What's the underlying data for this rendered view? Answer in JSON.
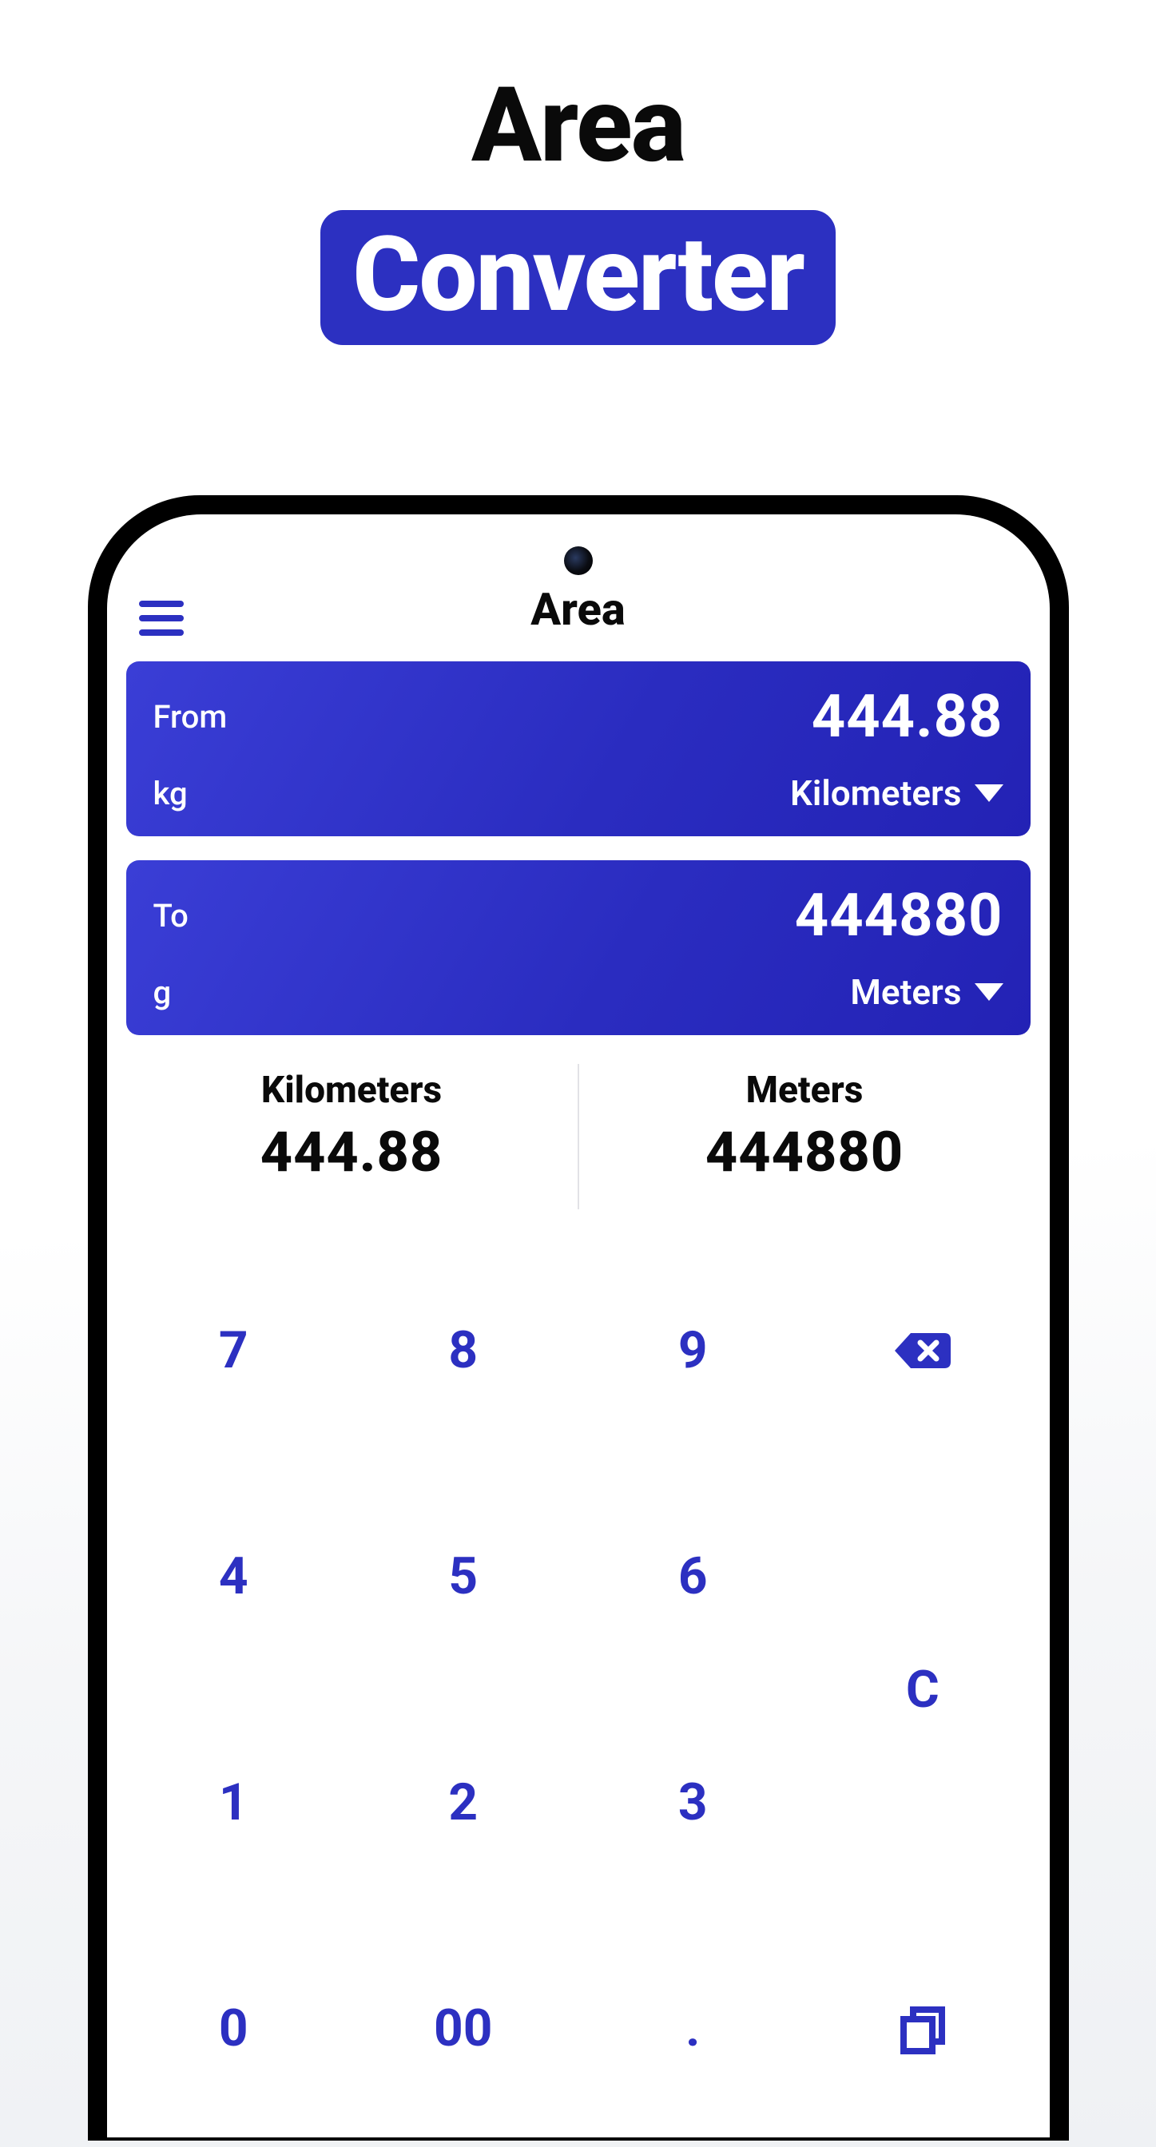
{
  "promo": {
    "line1": "Area",
    "line2": "Converter"
  },
  "appbar": {
    "title": "Area"
  },
  "from": {
    "label": "From",
    "abbr": "kg",
    "value": "444.88",
    "unit": "Kilometers"
  },
  "to": {
    "label": "To",
    "abbr": "g",
    "value": "444880",
    "unit": "Meters"
  },
  "readout": {
    "left_unit": "Kilometers",
    "left_value": "444.88",
    "right_unit": "Meters",
    "right_value": "444880"
  },
  "keypad": {
    "k7": "7",
    "k8": "8",
    "k9": "9",
    "k4": "4",
    "k5": "5",
    "k6": "6",
    "k1": "1",
    "k2": "2",
    "k3": "3",
    "k0": "0",
    "k00": "00",
    "kdot": ".",
    "clear": "C"
  },
  "colors": {
    "brand": "#2c30c1"
  }
}
